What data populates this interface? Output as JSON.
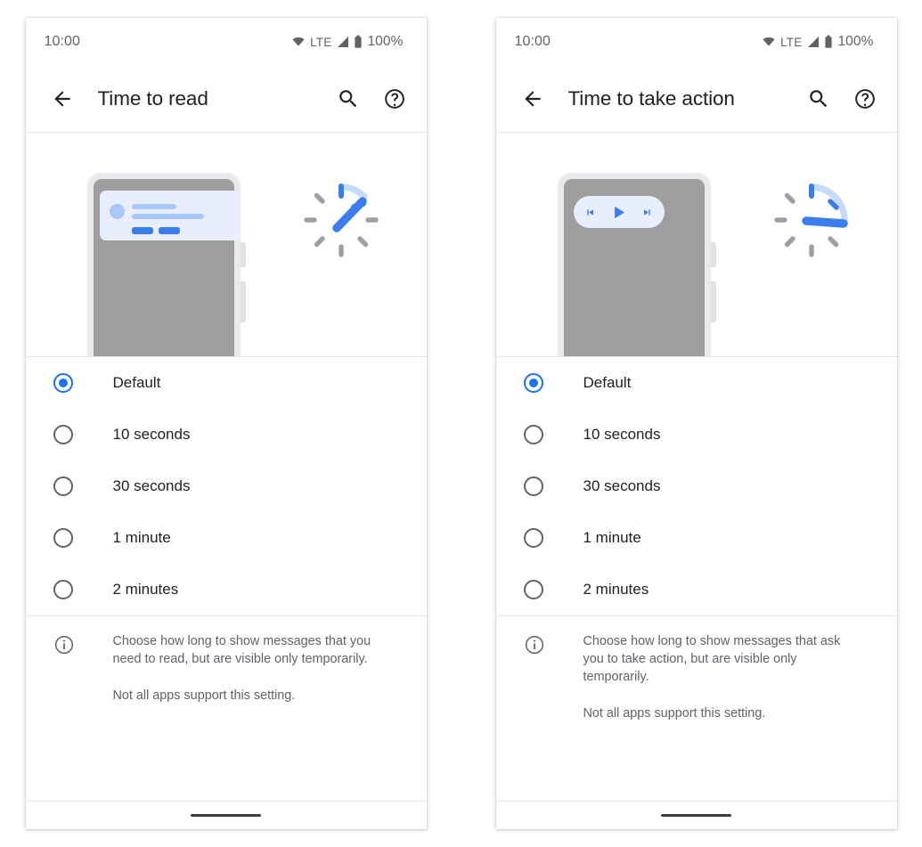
{
  "panels": [
    {
      "key": "time_to_read",
      "statusbar": {
        "time": "10:00",
        "wifi_icon": "wifi-icon",
        "network_label": "LTE",
        "signal_icon": "signal-bars-icon",
        "battery_icon": "battery-full-icon",
        "battery_level": "100%"
      },
      "appbar": {
        "back_icon": "arrow-back-icon",
        "title": "Time to read",
        "search_icon": "search-icon",
        "help_icon": "help-circle-icon"
      },
      "illustration": {
        "type": "phone-with-notification",
        "clock_icon": "timer-clock-icon",
        "notification_card": {
          "avatar": "avatar-placeholder",
          "line_1": "text-line-placeholder",
          "line_2": "text-line-placeholder",
          "action_1": "action-button-placeholder",
          "action_2": "action-button-placeholder"
        }
      },
      "options": [
        {
          "label": "Default",
          "selected": true
        },
        {
          "label": "10 seconds",
          "selected": false
        },
        {
          "label": "30 seconds",
          "selected": false
        },
        {
          "label": "1 minute",
          "selected": false
        },
        {
          "label": "2 minutes",
          "selected": false
        }
      ],
      "note": {
        "icon": "info-icon",
        "paragraph_1": "Choose how long to show messages that you need to read, but are visible only temporarily.",
        "paragraph_2": "Not all apps support this setting."
      },
      "navbar": {
        "handle": "home-gesture-handle"
      }
    },
    {
      "key": "time_to_take_action",
      "statusbar": {
        "time": "10:00",
        "wifi_icon": "wifi-icon",
        "network_label": "LTE",
        "signal_icon": "signal-bars-icon",
        "battery_icon": "battery-full-icon",
        "battery_level": "100%"
      },
      "appbar": {
        "back_icon": "arrow-back-icon",
        "title": "Time to take action",
        "search_icon": "search-icon",
        "help_icon": "help-circle-icon"
      },
      "illustration": {
        "type": "phone-with-media-controls",
        "clock_icon": "timer-clock-icon",
        "media_controls": {
          "previous_icon": "skip-previous-icon",
          "play_icon": "play-icon",
          "next_icon": "skip-next-icon"
        }
      },
      "options": [
        {
          "label": "Default",
          "selected": true
        },
        {
          "label": "10 seconds",
          "selected": false
        },
        {
          "label": "30 seconds",
          "selected": false
        },
        {
          "label": "1 minute",
          "selected": false
        },
        {
          "label": "2 minutes",
          "selected": false
        }
      ],
      "note": {
        "icon": "info-icon",
        "paragraph_1": "Choose how long to show messages that ask you to take action, but are visible only temporarily.",
        "paragraph_2": "Not all apps support this setting."
      },
      "navbar": {
        "handle": "home-gesture-handle"
      }
    }
  ],
  "colors": {
    "accent_blue": "#1a73e8",
    "clock_blue": "#3b7ded",
    "clock_blue_light": "#c6dafc",
    "tick_gray": "#9aa0a6",
    "text_primary": "#202124",
    "text_secondary": "#5f6368",
    "phone_screen_gray": "#9e9e9e",
    "phone_bezel_gray": "#e8eaed",
    "notification_bg": "#e8eefc",
    "notification_fg": "#a8c7fa",
    "divider": "#e6e6e6"
  }
}
